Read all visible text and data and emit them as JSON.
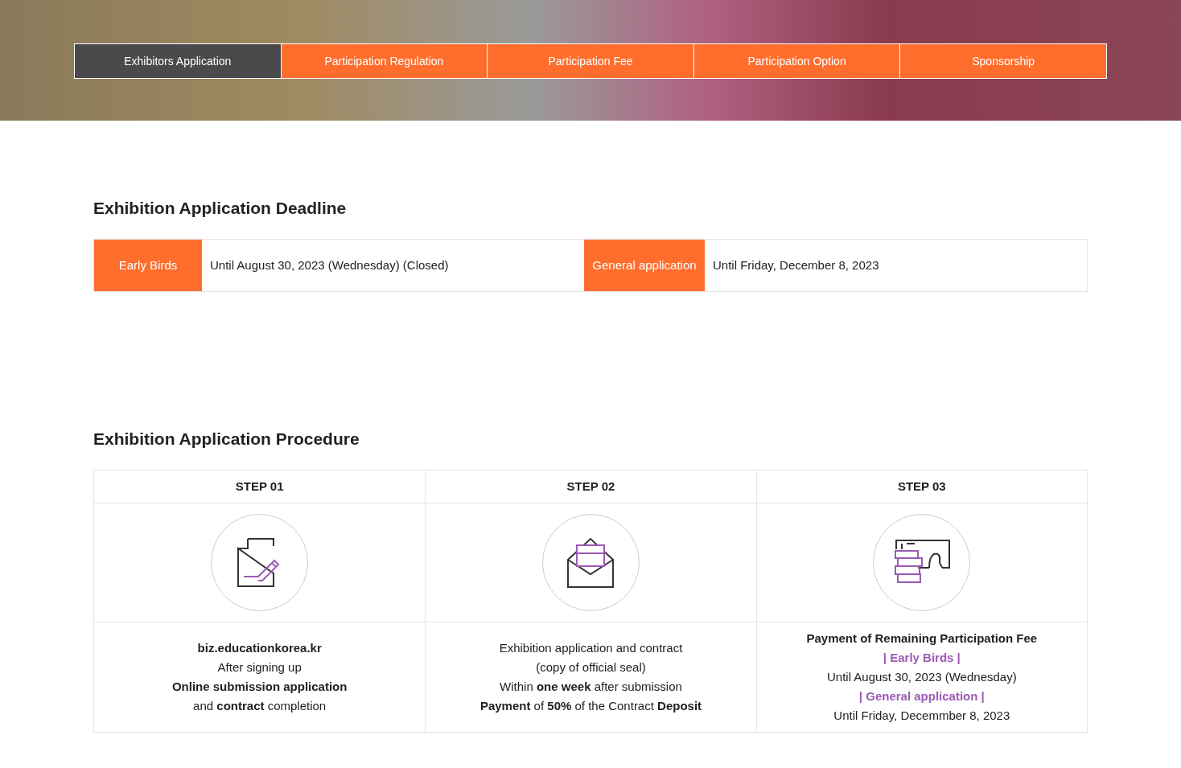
{
  "tabs": [
    {
      "label": "Exhibitors Application",
      "selected": true
    },
    {
      "label": "Participation Regulation",
      "selected": false
    },
    {
      "label": "Participation Fee",
      "selected": false
    },
    {
      "label": "Participation Option",
      "selected": false
    },
    {
      "label": "Sponsorship",
      "selected": false
    }
  ],
  "deadline": {
    "title": "Exhibition Application Deadline",
    "items": [
      {
        "label": "Early Birds",
        "value": "Until August 30, 2023 (Wednesday) (Closed)"
      },
      {
        "label": "General application",
        "value": "Until Friday, December 8, 2023"
      }
    ]
  },
  "procedure": {
    "title": "Exhibition Application Procedure",
    "steps": [
      {
        "label": "STEP 01",
        "lines": [
          {
            "kind": "bold",
            "text": "biz.educationkorea.kr"
          },
          {
            "kind": "plain",
            "text": "After signing up"
          },
          {
            "kind": "bold",
            "text": "Online submission application"
          },
          {
            "kind": "plain",
            "text": "and **contract** completion"
          }
        ]
      },
      {
        "label": "STEP 02",
        "lines": [
          {
            "kind": "plain",
            "text": "Exhibition application and contract"
          },
          {
            "kind": "plain",
            "text": "(copy of official seal)"
          },
          {
            "kind": "plain",
            "text": "Within **one week** after submission"
          },
          {
            "kind": "plain",
            "text": "**Payment** of **50%** of the Contract **Deposit**"
          }
        ]
      },
      {
        "label": "STEP 03",
        "lines": [
          {
            "kind": "bold",
            "text": "Payment of Remaining Participation Fee"
          },
          {
            "kind": "highlight",
            "text": "| Early Birds |"
          },
          {
            "kind": "plain",
            "text": "Until August 30, 2023 (Wednesday)"
          },
          {
            "kind": "highlight",
            "text": "| General application |"
          },
          {
            "kind": "plain",
            "text": "Until Friday, Decemmber 8, 2023"
          }
        ]
      }
    ]
  }
}
